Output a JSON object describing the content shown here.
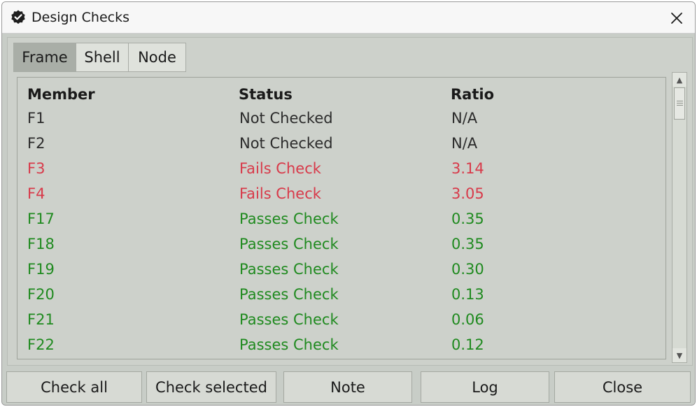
{
  "window": {
    "title": "Design Checks",
    "icon": "check-badge-icon",
    "close_icon": "close-icon"
  },
  "tabs": [
    {
      "label": "Frame",
      "active": true
    },
    {
      "label": "Shell",
      "active": false
    },
    {
      "label": "Node",
      "active": false
    }
  ],
  "table": {
    "columns": [
      "Member",
      "Status",
      "Ratio"
    ],
    "rows": [
      {
        "member": "F1",
        "status": "Not Checked",
        "ratio": "N/A",
        "color": "#2b2b2b"
      },
      {
        "member": "F2",
        "status": "Not Checked",
        "ratio": "N/A",
        "color": "#2b2b2b"
      },
      {
        "member": "F3",
        "status": "Fails Check",
        "ratio": "3.14",
        "color": "#d83a4a"
      },
      {
        "member": "F4",
        "status": "Fails Check",
        "ratio": "3.05",
        "color": "#d83a4a"
      },
      {
        "member": "F17",
        "status": "Passes Check",
        "ratio": "0.35",
        "color": "#1f8a1f"
      },
      {
        "member": "F18",
        "status": "Passes Check",
        "ratio": "0.35",
        "color": "#1f8a1f"
      },
      {
        "member": "F19",
        "status": "Passes Check",
        "ratio": "0.30",
        "color": "#1f8a1f"
      },
      {
        "member": "F20",
        "status": "Passes Check",
        "ratio": "0.13",
        "color": "#1f8a1f"
      },
      {
        "member": "F21",
        "status": "Passes Check",
        "ratio": "0.06",
        "color": "#1f8a1f"
      },
      {
        "member": "F22",
        "status": "Passes Check",
        "ratio": "0.12",
        "color": "#1f8a1f"
      }
    ]
  },
  "buttons": {
    "check_all": "Check all",
    "check_selected": "Check selected",
    "note": "Note",
    "log": "Log",
    "close": "Close"
  }
}
